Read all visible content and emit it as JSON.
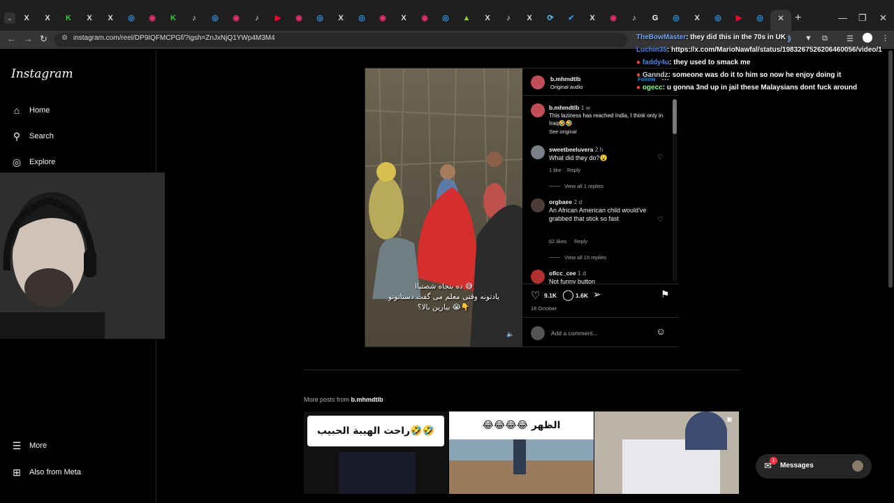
{
  "browser": {
    "url": "instagram.com/reel/DP9IQFMCPGf/?igsh=ZnJxNjQ1YWp4M3M4",
    "tab_icons": [
      "X",
      "X",
      "K",
      "X",
      "X",
      "◎",
      "◉",
      "K",
      "♪",
      "◎",
      "◉",
      "♪",
      "▶",
      "◉",
      "◎",
      "X",
      "◎",
      "◉",
      "X",
      "◉",
      "◎",
      "▲",
      "X",
      "♪",
      "X",
      "⟳",
      "✔",
      "X",
      "◉",
      "♪",
      "G",
      "◎",
      "X",
      "◎",
      "▶",
      "◎"
    ]
  },
  "sidebar": {
    "logo": "Instagram",
    "items": [
      {
        "label": "Home",
        "icon": "home-icon"
      },
      {
        "label": "Search",
        "icon": "search-icon"
      },
      {
        "label": "Explore",
        "icon": "explore-icon"
      }
    ],
    "bottom": [
      {
        "label": "More",
        "icon": "menu-icon"
      },
      {
        "label": "Also from Meta",
        "icon": "meta-icon"
      }
    ]
  },
  "post": {
    "author": "b.mhmdtlb",
    "audio": "Original audio",
    "follow": "Follow",
    "video_caption_line1": "ده بنجاه شصتیاا 😅",
    "video_caption_line2": "یادتونه وقتی معلم می گفت دستاتونو",
    "video_caption_line3": "بیارین بالا؟ 😭👇",
    "caption": {
      "user": "b.mhmdtlb",
      "time": "1 w",
      "text": "This laziness has reached India, I think only in Iraq🤣🤣",
      "see_original": "See original"
    },
    "comments": [
      {
        "user": "sweetbeeluvera",
        "time": "2 h",
        "text": "What did they do?😮",
        "likes": "1 like",
        "reply": "Reply",
        "view_replies": "View all 1 replies"
      },
      {
        "user": "orgbaee",
        "time": "2 d",
        "text": "An African American child would've grabbed that stick so fast",
        "likes": "62 likes",
        "reply": "Reply",
        "view_replies": "View all 15 replies"
      },
      {
        "user": "oficc_cee",
        "time": "1 d",
        "text": "Not funny button"
      }
    ],
    "like_count": "9.1K",
    "comment_count": "1.6K",
    "date": "18 October",
    "add_comment_placeholder": "Add a comment..."
  },
  "more_posts": {
    "label": "More posts from",
    "user": "b.mhmdtlb",
    "thumb_texts": [
      "راحت الهیبة الحبیب🤣🤣",
      "😂😂😂😂 الظهر",
      ""
    ]
  },
  "chat": [
    {
      "user": "TheBowMaster",
      "color": "#6fa8ff",
      "text": ": they did this in the 70s in UK"
    },
    {
      "user": "Luchin35",
      "color": "#4a86e8",
      "text": ": https://x.com/MarioNawfal/status/1983267526206460056/video/1"
    },
    {
      "user": "faddy4u",
      "color": "#4a86e8",
      "text": ": they used to smack me"
    },
    {
      "user": "Ganndz",
      "color": "#cccccc",
      "text": ": someone was do it to him so now he enjoy doing it"
    },
    {
      "user": "ogecc",
      "color": "#7fff7f",
      "text": ": u gonna 3nd up in jail these Malaysians dont fuck around"
    }
  ],
  "messages": {
    "label": "Messages",
    "badge": "1"
  }
}
